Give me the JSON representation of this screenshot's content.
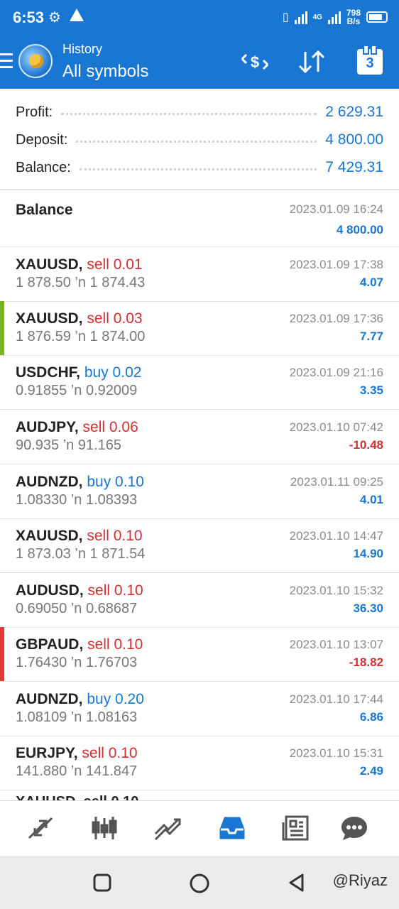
{
  "status": {
    "time": "6:53",
    "net_speed_top": "798",
    "net_speed_bottom": "B/s",
    "network_label": "4G"
  },
  "header": {
    "subtitle": "History",
    "title": "All symbols",
    "calendar_day": "3"
  },
  "summary": {
    "profit_label": "Profit:",
    "profit_value": "2 629.31",
    "deposit_label": "Deposit:",
    "deposit_value": "4 800.00",
    "balance_label": "Balance:",
    "balance_value": "7 429.31"
  },
  "balance_entry": {
    "label": "Balance",
    "date": "2023.01.09 16:24",
    "amount": "4 800.00"
  },
  "trades": [
    {
      "symbol": "XAUUSD,",
      "side": "sell 0.01",
      "side_color": "red",
      "prices": "1 878.50 ’n  1 874.43",
      "date": "2023.01.09 17:38",
      "profit": "4.07",
      "profit_color": "blue",
      "marker": ""
    },
    {
      "symbol": "XAUUSD,",
      "side": "sell 0.03",
      "side_color": "red",
      "prices": "1 876.59 ’n  1 874.00",
      "date": "2023.01.09 17:36",
      "profit": "7.77",
      "profit_color": "blue",
      "marker": "#7cb518"
    },
    {
      "symbol": "USDCHF,",
      "side": "buy 0.02",
      "side_color": "blue",
      "prices": "0.91855 ’n  0.92009",
      "date": "2023.01.09 21:16",
      "profit": "3.35",
      "profit_color": "blue",
      "marker": ""
    },
    {
      "symbol": "AUDJPY,",
      "side": "sell 0.06",
      "side_color": "red",
      "prices": "90.935 ’n  91.165",
      "date": "2023.01.10 07:42",
      "profit": "-10.48",
      "profit_color": "red",
      "marker": ""
    },
    {
      "symbol": "AUDNZD,",
      "side": "buy 0.10",
      "side_color": "blue",
      "prices": "1.08330 ’n  1.08393",
      "date": "2023.01.11 09:25",
      "profit": "4.01",
      "profit_color": "blue",
      "marker": ""
    },
    {
      "symbol": "XAUUSD,",
      "side": "sell 0.10",
      "side_color": "red",
      "prices": "1 873.03 ’n  1 871.54",
      "date": "2023.01.10 14:47",
      "profit": "14.90",
      "profit_color": "blue",
      "marker": ""
    },
    {
      "symbol": "AUDUSD,",
      "side": "sell 0.10",
      "side_color": "red",
      "prices": "0.69050 ’n  0.68687",
      "date": "2023.01.10 15:32",
      "profit": "36.30",
      "profit_color": "blue",
      "marker": ""
    },
    {
      "symbol": "GBPAUD,",
      "side": "sell 0.10",
      "side_color": "red",
      "prices": "1.76430 ’n  1.76703",
      "date": "2023.01.10 13:07",
      "profit": "-18.82",
      "profit_color": "red",
      "marker": "#e53935"
    },
    {
      "symbol": "AUDNZD,",
      "side": "buy 0.20",
      "side_color": "blue",
      "prices": "1.08109 ’n  1.08163",
      "date": "2023.01.10 17:44",
      "profit": "6.86",
      "profit_color": "blue",
      "marker": ""
    },
    {
      "symbol": "EURJPY,",
      "side": "sell 0.10",
      "side_color": "red",
      "prices": "141.880 ’n  141.847",
      "date": "2023.01.10 15:31",
      "profit": "2.49",
      "profit_color": "blue",
      "marker": ""
    }
  ],
  "partial_row": "XAUUSD, sell 0.10",
  "nav": {
    "items": [
      "quotes-icon",
      "chart-icon",
      "trade-icon",
      "history-icon",
      "news-icon",
      "messages-icon"
    ],
    "active_color": "#1976d2"
  },
  "watermark": "@Riyaz",
  "colors": {
    "accent": "#1976d2",
    "negative": "#d32f2f"
  }
}
